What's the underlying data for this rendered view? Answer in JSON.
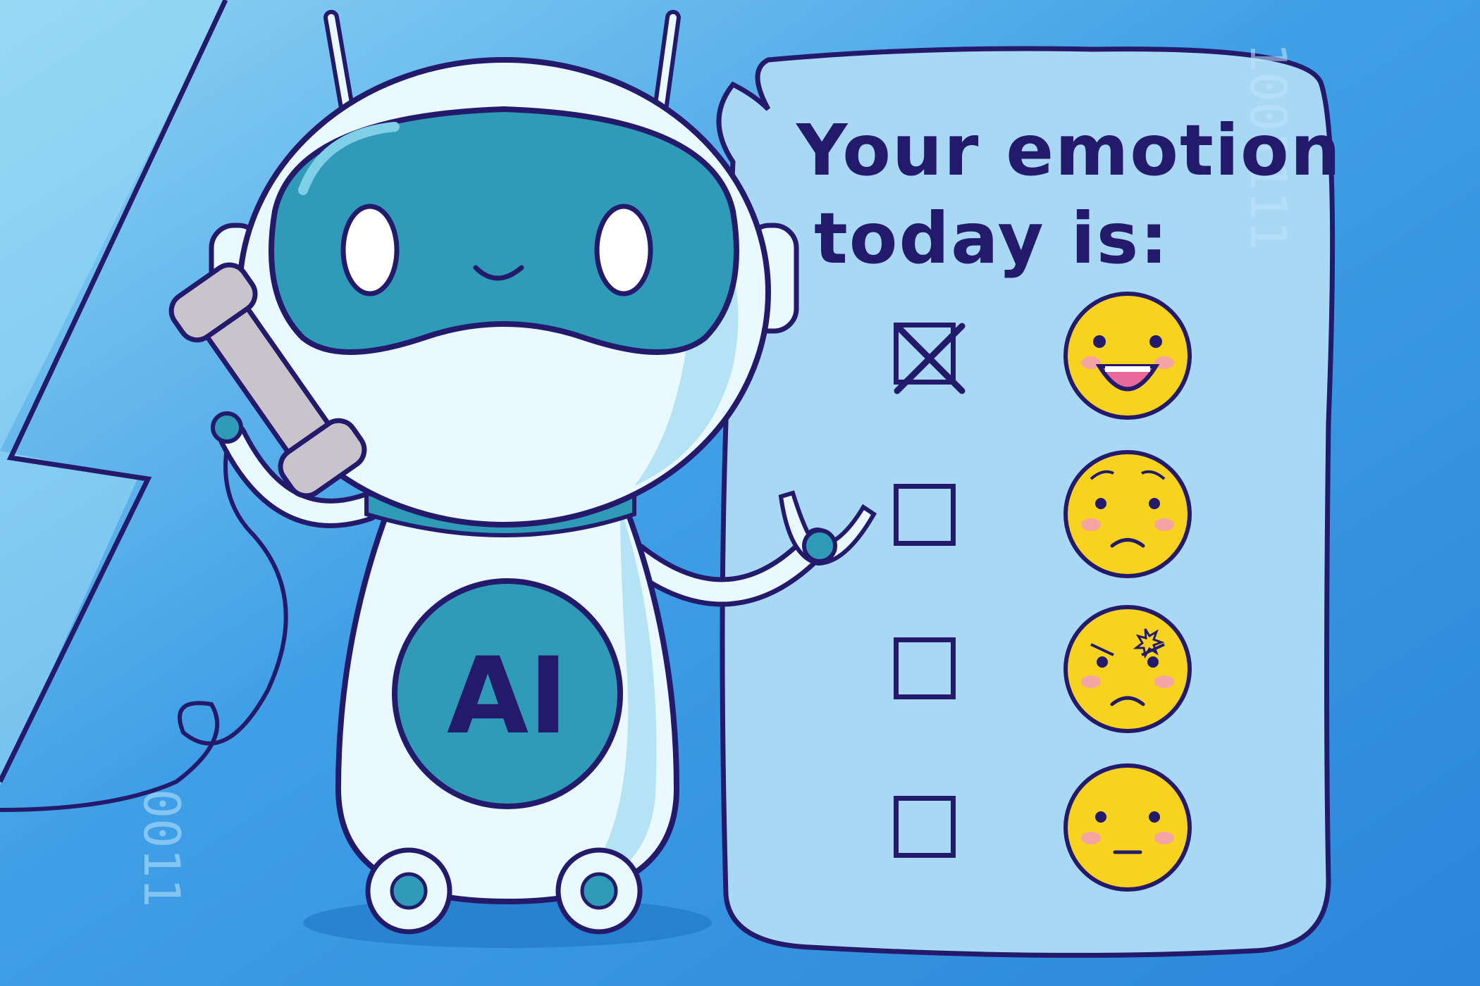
{
  "speech_bubble": {
    "line1": "Your emotion",
    "line2": "today is:"
  },
  "robot": {
    "badge_text": "AI"
  },
  "options": [
    {
      "emotion": "happy-face-icon",
      "checked": true
    },
    {
      "emotion": "worried-face-icon",
      "checked": false
    },
    {
      "emotion": "angry-face-icon",
      "checked": false
    },
    {
      "emotion": "neutral-face-icon",
      "checked": false
    }
  ],
  "colors": {
    "outline": "#241a6b",
    "background": "#2f8fe0",
    "visor": "#2f9bb8",
    "bubble": "#a9d8f5",
    "face": "#f7d21e"
  }
}
